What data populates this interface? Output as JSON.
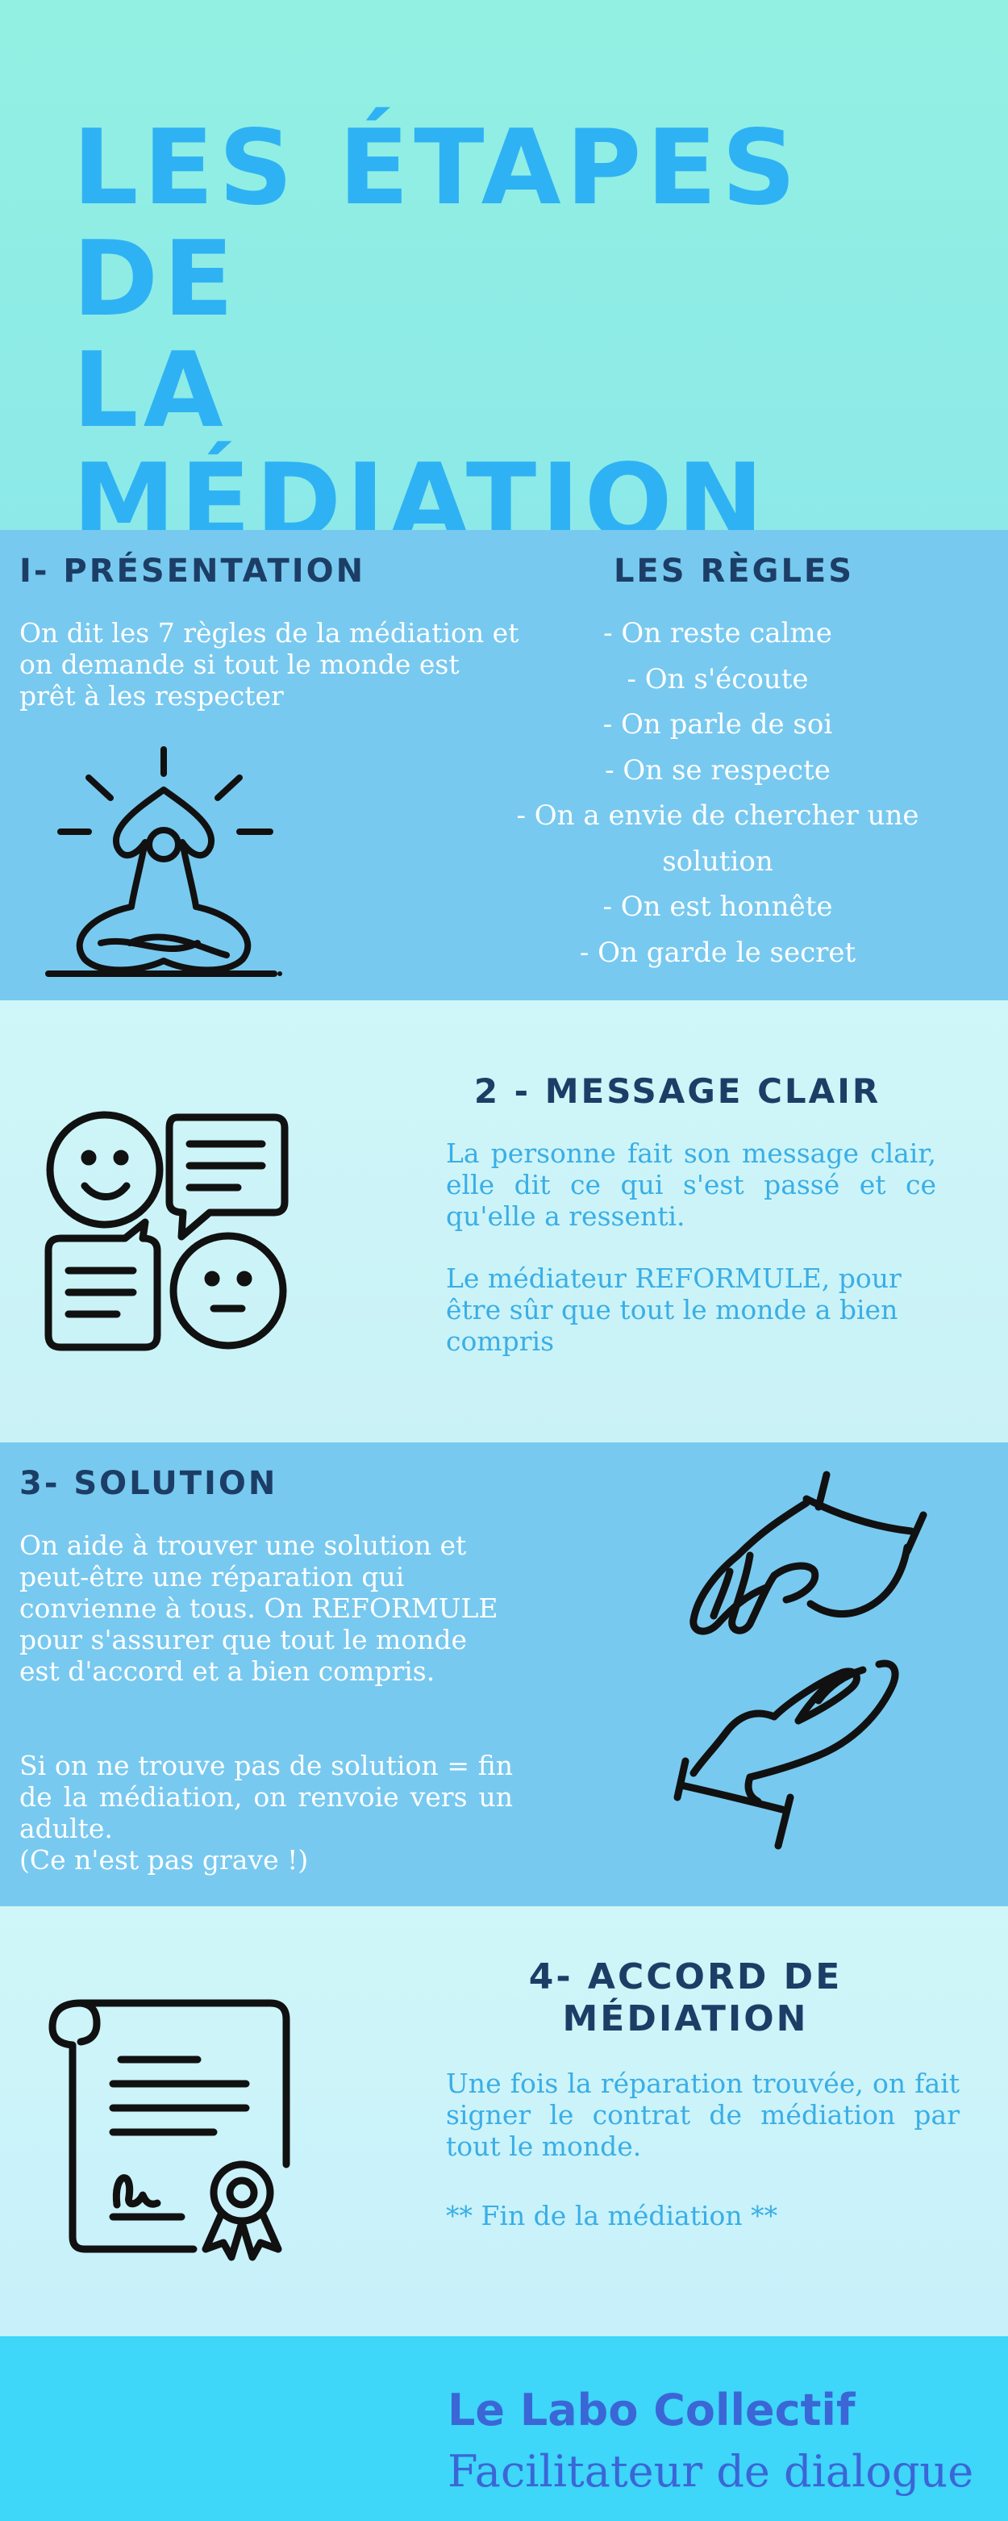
{
  "header": {
    "title": "LES ÉTAPES DE\nLA MÉDIATION"
  },
  "section1": {
    "heading": "I- PRÉSENTATION",
    "text": "On dit les 7 règles de la médiation et on demande si tout le monde est prêt à les respecter",
    "icon": "meditation-icon"
  },
  "rules": {
    "heading": "LES RÈGLES",
    "items": [
      "- On reste calme",
      "- On s'écoute",
      "- On parle de soi",
      "- On se respecte",
      "- On a envie de chercher une",
      "solution",
      "- On est honnête",
      "- On garde le secret"
    ]
  },
  "section2": {
    "heading": "2 - MESSAGE CLAIR",
    "text1": "La personne fait son message clair, elle dit ce qui s'est passé et ce qu'elle a ressenti.",
    "text2": "Le médiateur REFORMULE, pour être sûr que tout le monde a bien compris",
    "icon": "chat-faces-icon"
  },
  "section3": {
    "heading": "3- SOLUTION",
    "text1": "On aide à trouver une solution et peut-être une réparation qui convienne à tous. On REFORMULE pour s'assurer que tout le monde est d'accord et a bien compris.",
    "text2": "Si on ne trouve pas de solution = fin de la médiation, on renvoie vers un adulte.",
    "text3": "(Ce n'est pas grave !)",
    "icon": "helping-hands-icon"
  },
  "section4": {
    "heading": "4- ACCORD DE\nMÉDIATION",
    "text1": "Une fois la réparation trouvée, on fait signer le contrat de médiation par tout le monde.",
    "text2": "** Fin de la médiation **",
    "icon": "contract-icon"
  },
  "footer": {
    "brand": "Le Labo Collectif",
    "subtitle": "Facilitateur de dialogue"
  },
  "colors": {
    "title": "#2fb2f3",
    "heading": "#1c3e66",
    "blue_text": "#3aaee6",
    "footer_text": "#3b66d6",
    "band_blue": "#78c9ef",
    "band_light": "#cff6f8",
    "footer_bg": "#3ed6f9"
  }
}
